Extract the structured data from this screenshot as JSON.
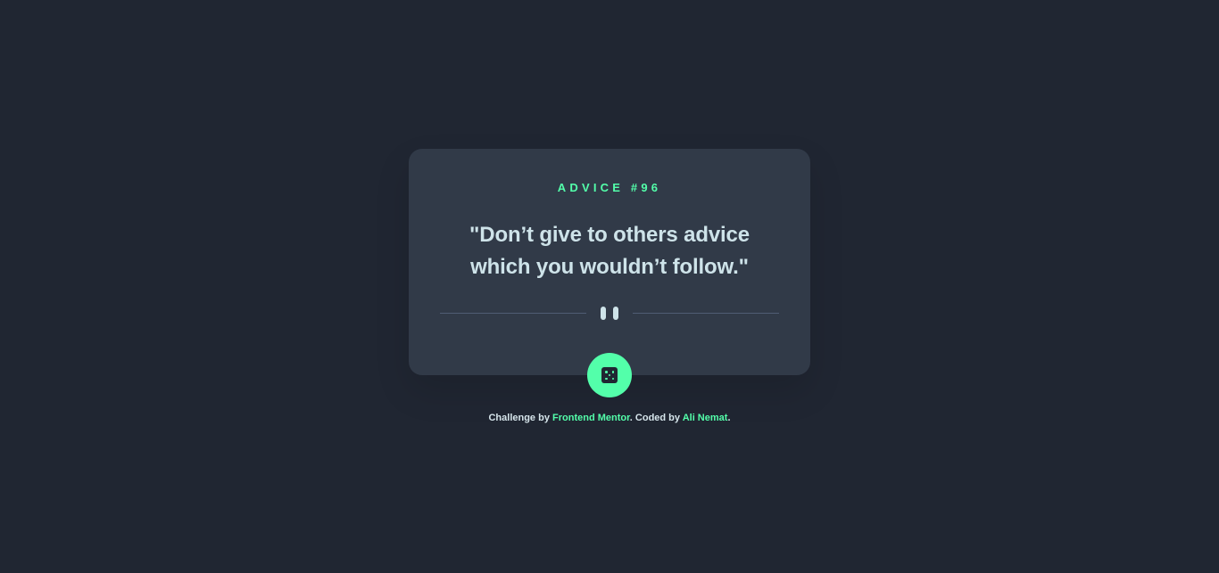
{
  "card": {
    "advice_label": "ADVICE #96",
    "quote": "\"Don’t give to others advice which you wouldn’t follow.\""
  },
  "controls": {
    "dice_button_label": "",
    "dice_icon": "dice-icon",
    "divider_icon": "pause-icon"
  },
  "attribution": {
    "challenge_prefix": "Challenge by",
    "frontend_mentor": "Frontend Mentor",
    "coded_by_text": ". Coded by",
    "author": "Ali Nemat",
    "end_period": "."
  },
  "colors": {
    "background": "#202632",
    "card": "#313a48",
    "accent": "#53ffaa",
    "text": "#cee3e9",
    "divider": "#4f5d74"
  }
}
